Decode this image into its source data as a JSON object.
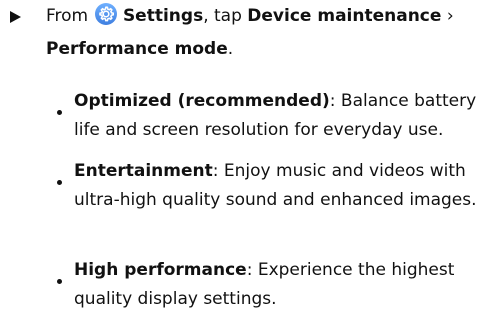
{
  "step": {
    "prefix": "From",
    "settings_label": "Settings",
    "middle": ", tap",
    "device_label": "Device maintenance",
    "separator": " ›",
    "performance_label": "Performance mode",
    "end": "."
  },
  "icons": {
    "settings": "settings-gear-icon",
    "settings_color": "#4a8fe8"
  },
  "options": [
    {
      "title": "Optimized (recommended)",
      "separator": ":",
      "description": "Balance battery life and screen resolution for everyday use."
    },
    {
      "title": "Entertainment",
      "separator": ":",
      "description": "Enjoy music and videos with ultra-high quality sound and enhanced images."
    },
    {
      "title": "High performance",
      "separator": ":",
      "description": "Experience the highest quality display settings."
    }
  ]
}
